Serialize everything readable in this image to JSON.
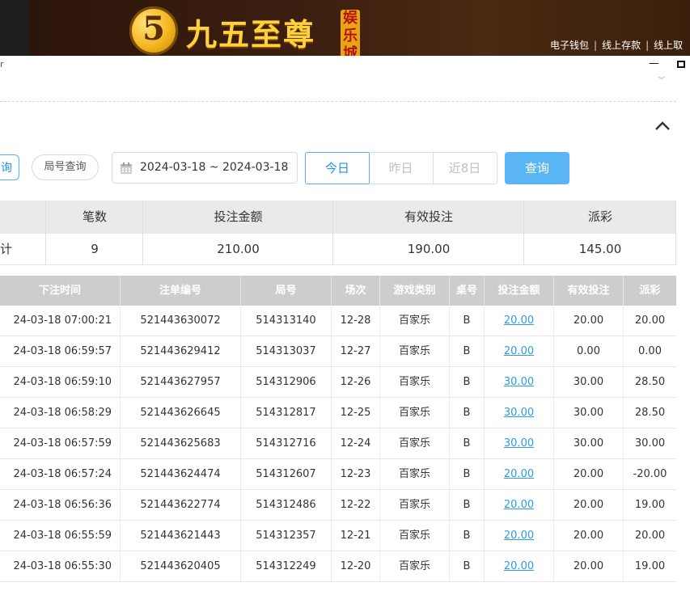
{
  "banner": {
    "logo_char": "5",
    "title": "九五至尊",
    "badge": "娱乐城",
    "links": [
      "电子钱包",
      "线上存款",
      "线上取"
    ]
  },
  "window": {
    "title_fragment": "r"
  },
  "filters": {
    "query_tab_partial": "询",
    "round_query": "局号查询",
    "date_range": "2024-03-18 ~ 2024-03-18",
    "segments": [
      "今日",
      "昨日",
      "近8日"
    ],
    "query_button": "查询"
  },
  "summary": {
    "headers": [
      "",
      "笔数",
      "投注金额",
      "有效投注",
      "派彩"
    ],
    "row": [
      "计",
      "9",
      "210.00",
      "190.00",
      "145.00"
    ]
  },
  "detail": {
    "headers": [
      "下注时间",
      "注单编号",
      "局号",
      "场次",
      "游戏类别",
      "桌号",
      "投注金额",
      "有效投注",
      "派彩"
    ],
    "rows": [
      [
        "24-03-18 07:00:21",
        "521443630072",
        "514313140",
        "12-28",
        "百家乐",
        "B",
        "20.00",
        "20.00",
        "20.00"
      ],
      [
        "24-03-18 06:59:57",
        "521443629412",
        "514313037",
        "12-27",
        "百家乐",
        "B",
        "20.00",
        "0.00",
        "0.00"
      ],
      [
        "24-03-18 06:59:10",
        "521443627957",
        "514312906",
        "12-26",
        "百家乐",
        "B",
        "30.00",
        "30.00",
        "28.50"
      ],
      [
        "24-03-18 06:58:29",
        "521443626645",
        "514312817",
        "12-25",
        "百家乐",
        "B",
        "30.00",
        "30.00",
        "28.50"
      ],
      [
        "24-03-18 06:57:59",
        "521443625683",
        "514312716",
        "12-24",
        "百家乐",
        "B",
        "30.00",
        "30.00",
        "30.00"
      ],
      [
        "24-03-18 06:57:24",
        "521443624474",
        "514312607",
        "12-23",
        "百家乐",
        "B",
        "20.00",
        "20.00",
        "-20.00"
      ],
      [
        "24-03-18 06:56:36",
        "521443622774",
        "514312486",
        "12-22",
        "百家乐",
        "B",
        "20.00",
        "20.00",
        "19.00"
      ],
      [
        "24-03-18 06:55:59",
        "521443621443",
        "514312357",
        "12-21",
        "百家乐",
        "B",
        "20.00",
        "20.00",
        "20.00"
      ],
      [
        "24-03-18 06:55:30",
        "521443620405",
        "514312249",
        "12-20",
        "百家乐",
        "B",
        "20.00",
        "20.00",
        "19.00"
      ]
    ]
  },
  "colors": {
    "accent": "#1e95e6",
    "query_button": "#5ab5f4",
    "negative": "#e8383d",
    "table_header": "#cdcdcd"
  },
  "icons": [
    "calendar-icon",
    "chevron-up-icon",
    "chevron-down-icon",
    "minimize-icon",
    "maximize-icon"
  ]
}
